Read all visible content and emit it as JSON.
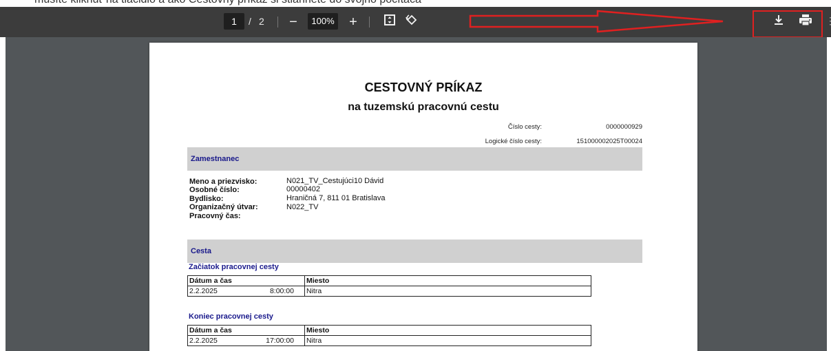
{
  "top_text": "musíte kliknúť na tlačidlo a ako Cestovný príkaz si stiahnete do svojho počítača",
  "toolbar": {
    "current_page": "1",
    "page_separator": "/",
    "total_pages": "2",
    "zoom_out": "−",
    "zoom_level": "100%",
    "zoom_in": "+",
    "icons": [
      "fit-page-icon",
      "rotate-icon",
      "download-icon",
      "print-icon",
      "more-icon"
    ]
  },
  "annotation_color": "#e02020",
  "document": {
    "title": "CESTOVNÝ PRÍKAZ",
    "subtitle": "na tuzemskú pracovnú cestu",
    "trip_number_label": "Číslo cesty:",
    "trip_number_value": "0000000929",
    "logical_number_label": "Logické číslo cesty:",
    "logical_number_value": "151000002025T00024",
    "employee_section": "Zamestnanec",
    "employee": [
      {
        "label": "Meno a priezvisko:",
        "value": "N021_TV_Cestujúci10 Dávid"
      },
      {
        "label": "Osobné číslo:",
        "value": "00000402"
      },
      {
        "label": "Bydlisko:",
        "value": "Hraničná 7, 811 01 Bratislava"
      },
      {
        "label": "Organizačný útvar:",
        "value": "N022_TV"
      },
      {
        "label": "Pracovný čas:",
        "value": ""
      }
    ],
    "trip_section": "Cesta",
    "start": {
      "heading": "Začiatok pracovnej cesty",
      "col_datetime": "Dátum a čas",
      "col_place": "Miesto",
      "date": "2.2.2025",
      "time": "8:00:00",
      "place": "Nitra"
    },
    "end": {
      "heading": "Koniec pracovnej cesty",
      "col_datetime": "Dátum a čas",
      "col_place": "Miesto",
      "date": "2.2.2025",
      "time": "17:00:00",
      "place": "Nitra"
    }
  }
}
